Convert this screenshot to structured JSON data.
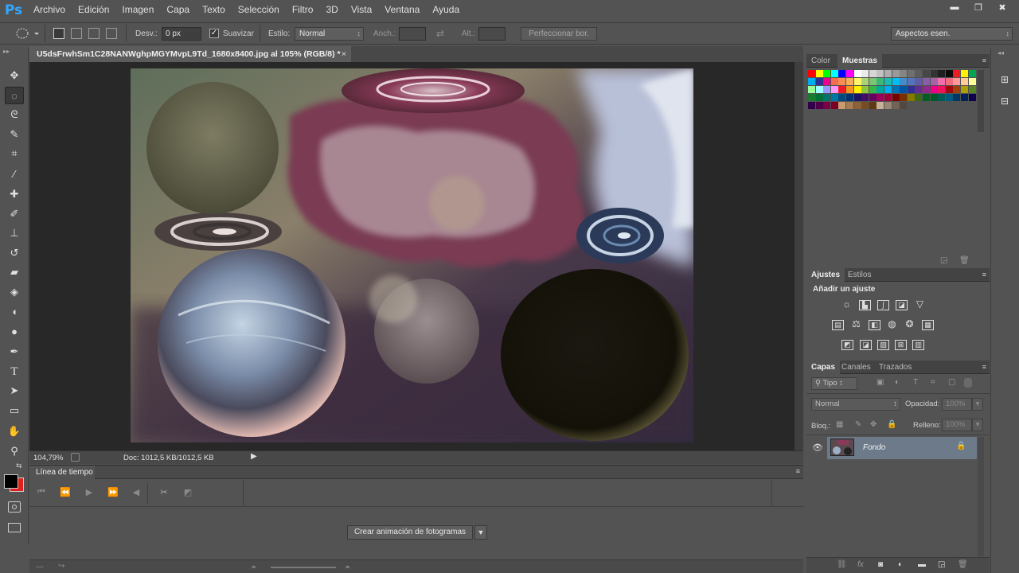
{
  "app": {
    "logo": "Ps"
  },
  "menu": [
    "Archivo",
    "Edición",
    "Imagen",
    "Capa",
    "Texto",
    "Selección",
    "Filtro",
    "3D",
    "Vista",
    "Ventana",
    "Ayuda"
  ],
  "window_controls": {
    "minimize": "▬",
    "restore": "❐",
    "close": "✖"
  },
  "options": {
    "feather_label": "Desv.:",
    "feather_value": "0 px",
    "antialias_label": "Suavizar",
    "antialias_checked": true,
    "style_label": "Estilo:",
    "style_value": "Normal",
    "width_label": "Anch.:",
    "height_label": "Alt.:",
    "refine_edge": "Perfeccionar bor.",
    "workspace": "Aspectos esen."
  },
  "document": {
    "tab_title": "U5dsFrwhSm1C28NANWghpMGYMvpL9Td_1680x8400.jpg al 105% (RGB/8) *",
    "tab_close": "×"
  },
  "status": {
    "zoom": "104,79%",
    "doc_size": "Doc: 1012,5 KB/1012,5 KB"
  },
  "timeline": {
    "tab": "Línea de tiempo",
    "create_button": "Crear animación de fotogramas"
  },
  "panels": {
    "color_tabs": [
      "Color",
      "Muestras"
    ],
    "adjust_tabs": [
      "Ajustes",
      "Estilos"
    ],
    "add_adjustment": "Añadir un ajuste",
    "layers_tabs": [
      "Capas",
      "Canales",
      "Trazados"
    ],
    "filter_kind": "Tipo",
    "blend_mode": "Normal",
    "opacity_label": "Opacidad:",
    "opacity_value": "100%",
    "lock_label": "Bloq.:",
    "fill_label": "Relleno:",
    "fill_value": "100%",
    "layer_name": "Fondo"
  },
  "colors": {
    "foreground": "#000000",
    "background": "#e0201c",
    "accent_blue": "#31a8ff"
  }
}
